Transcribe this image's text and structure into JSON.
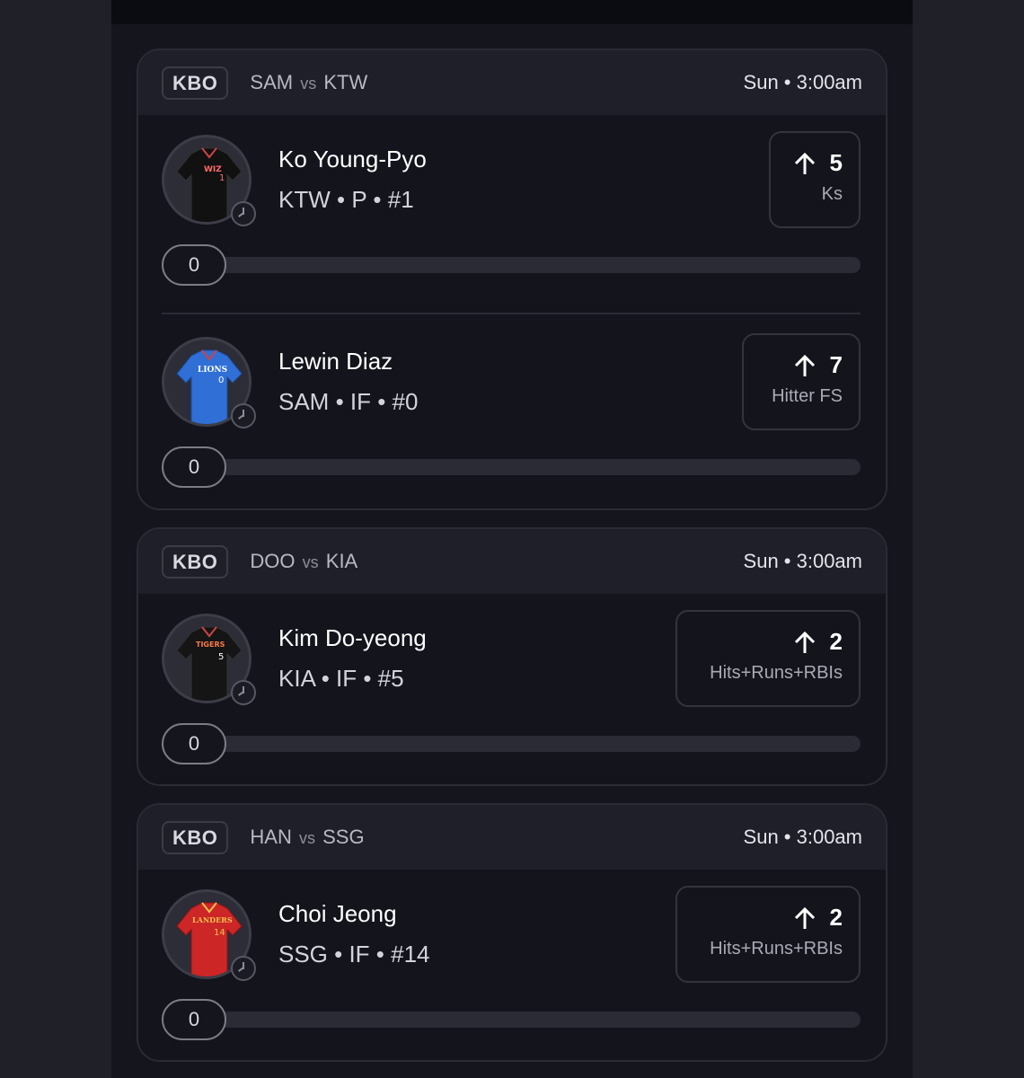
{
  "cards": [
    {
      "league": "KBO",
      "home": "SAM",
      "vs": "vs",
      "away": "KTW",
      "time": "Sun • 3:00am",
      "players": [
        {
          "name": "Ko Young-Pyo",
          "meta": "KTW • P • #1",
          "jersey_text": "WIZ",
          "jersey_number": "1",
          "jersey_color": "#111111",
          "proj_value": "5",
          "proj_label": "Ks",
          "progress_value": "0",
          "progress_fraction": 0
        },
        {
          "name": "Lewin Diaz",
          "meta": "SAM • IF • #0",
          "jersey_text": "LIONS",
          "jersey_number": "0",
          "jersey_color": "#2f6fd6",
          "proj_value": "7",
          "proj_label": "Hitter FS",
          "progress_value": "0",
          "progress_fraction": 0
        }
      ]
    },
    {
      "league": "KBO",
      "home": "DOO",
      "vs": "vs",
      "away": "KIA",
      "time": "Sun • 3:00am",
      "players": [
        {
          "name": "Kim Do-yeong",
          "meta": "KIA • IF • #5",
          "jersey_text": "TIGERS",
          "jersey_number": "5",
          "jersey_color": "#151515",
          "proj_value": "2",
          "proj_label": "Hits+Runs+RBIs",
          "progress_value": "0",
          "progress_fraction": 0
        }
      ]
    },
    {
      "league": "KBO",
      "home": "HAN",
      "vs": "vs",
      "away": "SSG",
      "time": "Sun • 3:00am",
      "players": [
        {
          "name": "Choi Jeong",
          "meta": "SSG • IF • #14",
          "jersey_text": "LANDERS",
          "jersey_number": "14",
          "jersey_color": "#cc2626",
          "proj_value": "2",
          "proj_label": "Hits+Runs+RBIs",
          "progress_value": "0",
          "progress_fraction": 0
        }
      ]
    }
  ]
}
